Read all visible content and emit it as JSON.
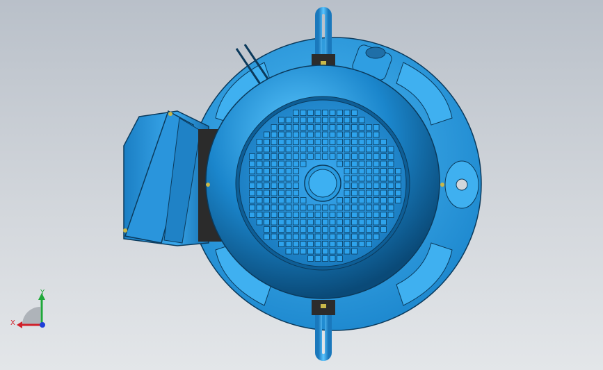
{
  "viewport": {
    "background_top": "#b9c0c9",
    "background_bottom": "#e3e6e9"
  },
  "model": {
    "body_color": "#2a9be0",
    "body_dark": "#0e5e96",
    "flange_color": "#36a6ea",
    "outline_color": "#0b3a5c",
    "hardware_color": "#c9b84a",
    "part_name": "electric-motor"
  },
  "triad": {
    "x_label": "X",
    "y_label": "Y",
    "x_color": "#d0202a",
    "y_color": "#1fa83a",
    "z_color": "#1f3fd8"
  }
}
